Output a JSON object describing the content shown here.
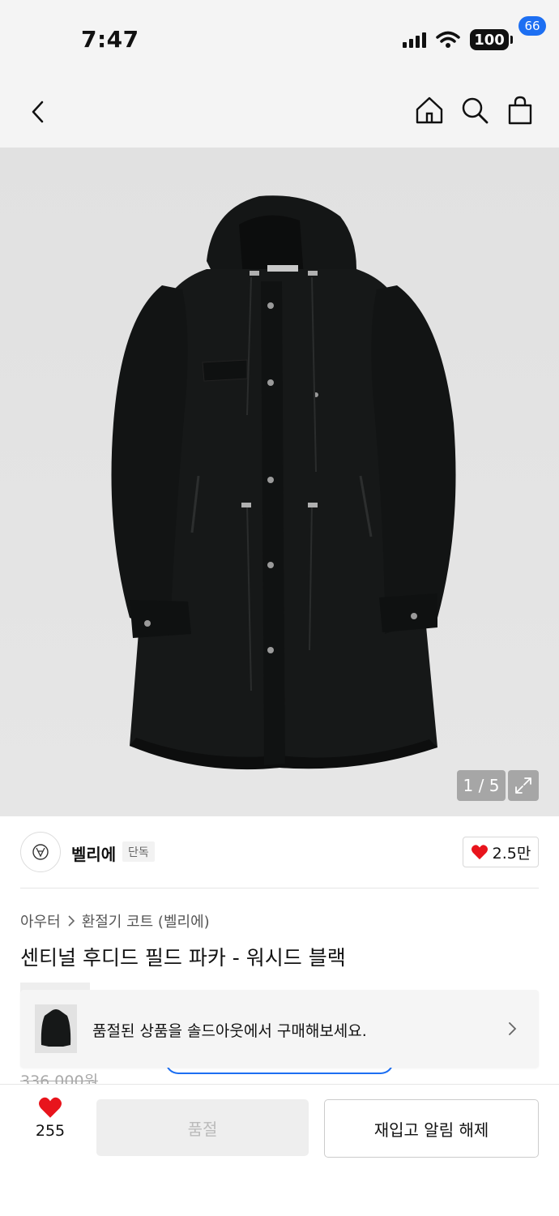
{
  "status_bar": {
    "time": "7:47",
    "battery": "100"
  },
  "nav": {
    "cart_count": "66"
  },
  "gallery": {
    "page_indicator": "1 / 5"
  },
  "brand": {
    "name": "벨리에",
    "exclusive_tag": "단독",
    "likes": "2.5만"
  },
  "breadcrumb": {
    "category": "아우터",
    "subcategory": "환절기 코트 (벨리에)"
  },
  "product": {
    "title": "센티널 후디드 필드 파카 - 워시드 블랙",
    "original_price": "336,000원"
  },
  "soldout_banner": {
    "text": "품절된 상품을 솔드아웃에서 구매해보세요."
  },
  "bottom_bar": {
    "wish_count": "255",
    "soldout_label": "품절",
    "restock_label": "재입고 알림 해제"
  },
  "colors": {
    "accent_blue": "#1d6ff2",
    "heart_red": "#e8141c",
    "hero_bg": "#e3e3e3"
  },
  "icons": [
    "back-icon",
    "home-icon",
    "search-icon",
    "shopping-bag-icon",
    "expand-icon",
    "heart-icon",
    "chevron-right-icon"
  ]
}
